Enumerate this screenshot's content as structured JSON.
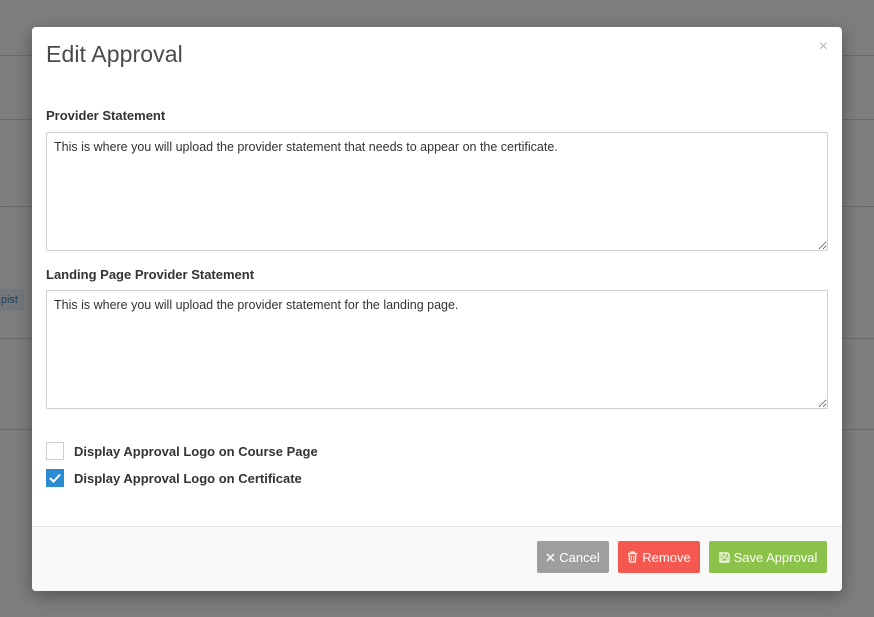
{
  "background": {
    "chip_text": "pist"
  },
  "modal": {
    "title": "Edit Approval",
    "close_symbol": "×",
    "provider_statement": {
      "label": "Provider Statement",
      "value": "This is where you will upload the provider statement that needs to appear on the certificate."
    },
    "landing_statement": {
      "label": "Landing Page Provider Statement",
      "value": "This is where you will upload the provider statement for the landing page."
    },
    "checkboxes": [
      {
        "label": "Display Approval Logo on Course Page",
        "checked": false
      },
      {
        "label": "Display Approval Logo on Certificate",
        "checked": true
      }
    ]
  },
  "footer": {
    "cancel_label": "Cancel",
    "remove_label": "Remove",
    "save_label": "Save Approval"
  },
  "icons": {
    "cancel": "x-icon",
    "remove": "trash-icon",
    "save": "save-icon",
    "check": "checkmark-icon"
  },
  "colors": {
    "accent": "#2e8ad0",
    "cancel": "#9e9e9e",
    "remove": "#f4584f",
    "save": "#8bc34a",
    "backdrop": "rgba(0,0,0,0.5)"
  }
}
